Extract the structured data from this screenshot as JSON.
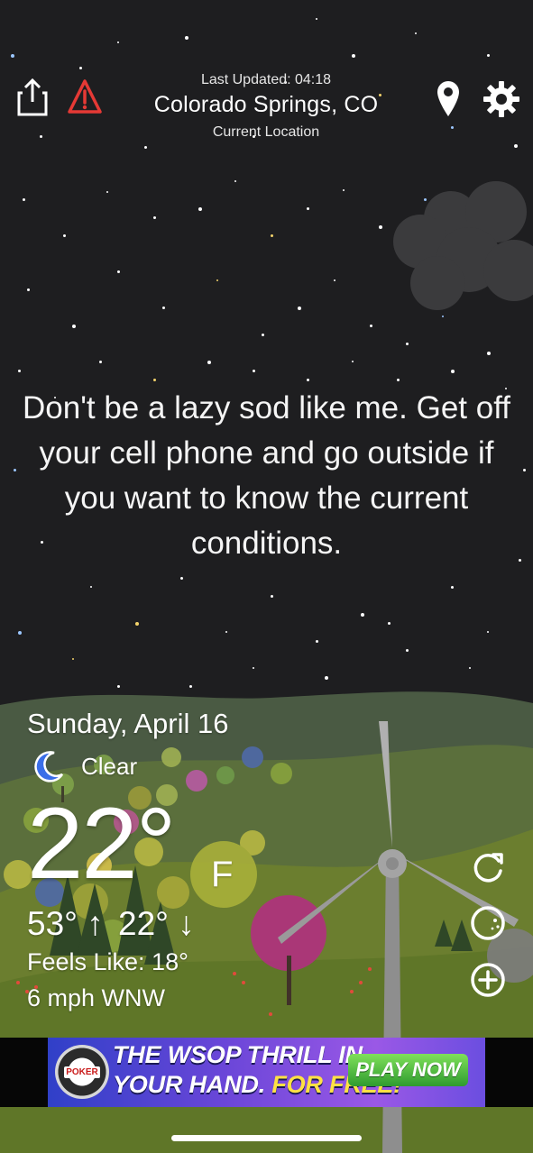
{
  "header": {
    "last_updated": "Last Updated: 04:18",
    "location": "Colorado Springs, CO",
    "location_type": "Current Location"
  },
  "icons": {
    "share": "share-icon",
    "alert": "warning-icon",
    "location": "location-pin-icon",
    "settings": "gear-icon",
    "condition": "moon-icon",
    "refresh": "refresh-icon",
    "moon_phase": "moon-phase-icon",
    "add": "add-icon"
  },
  "quote": "Don't be a lazy sod like me. Get off your cell phone and go outside if you want to know the current conditions.",
  "weather": {
    "day": "Sunday, April 16",
    "condition": "Clear",
    "temperature": "22°",
    "unit": "F",
    "high": "53° ↑",
    "low": "22° ↓",
    "feels_like": "Feels Like: 18°",
    "wind": "6 mph WNW"
  },
  "ad": {
    "logo_text": "POKER",
    "line1": "THE WSOP THRILL IN",
    "line2_a": "YOUR HAND.",
    "line2_b": "FOR FREE!",
    "cta": "PLAY NOW"
  },
  "colors": {
    "background": "#1e1e20",
    "warning_red": "#e53935",
    "moon_blue": "#3a6ee8",
    "cta_green": "#4cbf3f"
  }
}
